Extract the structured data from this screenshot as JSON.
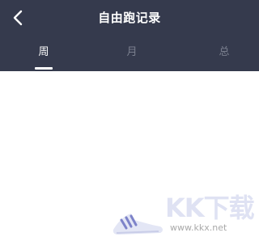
{
  "header": {
    "title": "自由跑记录",
    "back_icon": "chevron-left-icon"
  },
  "tabs": [
    {
      "label": "周",
      "active": true
    },
    {
      "label": "月",
      "active": false
    },
    {
      "label": "总",
      "active": false
    }
  ],
  "colors": {
    "header_bg": "#353a4d",
    "tab_active": "#ffffff",
    "tab_inactive": "#7a7f8e",
    "content_bg": "#ffffff"
  },
  "watermark": {
    "logo_text": "KK下载",
    "url": "www.kkx.net",
    "icon": "sneaker-icon"
  }
}
